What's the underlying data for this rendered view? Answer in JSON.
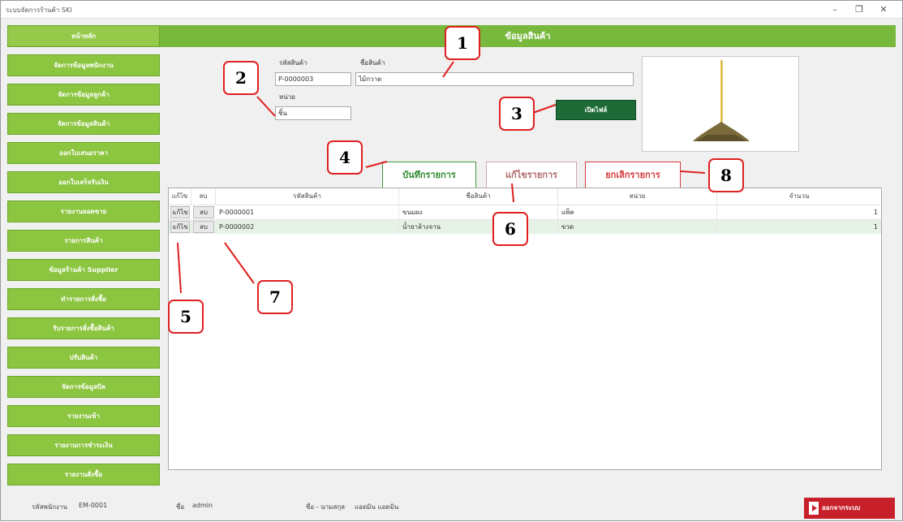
{
  "window": {
    "title": "ระบบจัดการร้านค้า SKI",
    "minimize": "–",
    "maximize": "❐",
    "close": "✕"
  },
  "sidebar": {
    "items": [
      {
        "label": "หน้าหลัก"
      },
      {
        "label": "จัดการข้อมูลพนักงาน"
      },
      {
        "label": "จัดการข้อมูลลูกค้า"
      },
      {
        "label": "จัดการข้อมูลสินค้า"
      },
      {
        "label": "ออกใบเสนอราคา"
      },
      {
        "label": "ออกใบเสร็จรับเงิน"
      },
      {
        "label": "รายงานยอดขาย"
      },
      {
        "label": "รายการสินค้า"
      },
      {
        "label": "ข้อมูลร้านค้า Supplier"
      },
      {
        "label": "ทำรายการสั่งซื้อ"
      },
      {
        "label": "รับรายการสั่งซื้อสินค้า"
      },
      {
        "label": "ปรับสินค้า"
      },
      {
        "label": "จัดการข้อมูลบิล"
      },
      {
        "label": "รายงานเข้า"
      },
      {
        "label": "รายงานการชำระเงิน"
      },
      {
        "label": "รายงานสั่งซื้อ"
      }
    ]
  },
  "header": {
    "title": "ข้อมูลสินค้า"
  },
  "form": {
    "code_label": "รหัสสินค้า",
    "code_value": "P-0000003",
    "name_label": "ชื่อสินค้า",
    "name_value": "ไม้กวาด",
    "unit_label": "หน่วย",
    "unit_value": "ชิ้น",
    "open_button": "เปิดไฟล์"
  },
  "actions": {
    "save": "บันทึกรายการ",
    "edit": "แก้ไขรายการ",
    "delete": "ยกเลิกรายการ"
  },
  "grid": {
    "columns": [
      "แก้ไข",
      "ลบ",
      "รหัสสินค้า",
      "ชื่อสินค้า",
      "หน่วย",
      "จำนวน"
    ],
    "rows": [
      {
        "edit": "แก้ไข",
        "del": "ลบ",
        "code": "P-0000001",
        "name": "ขนมผง",
        "unit": "แพ็ค",
        "qty": "1"
      },
      {
        "edit": "แก้ไข",
        "del": "ลบ",
        "code": "P-0000002",
        "name": "น้ำยาล้างจาน",
        "unit": "ขวด",
        "qty": "1"
      }
    ]
  },
  "footer": {
    "emp_label": "รหัสพนักงาน",
    "emp_value": "EM-0001",
    "user_label": "ชื่อ",
    "user_value": "admin",
    "name_label": "ชื่อ - นามสกุล",
    "name_value": "แอดมิน แอดมิน",
    "logout": "ออกจากระบบ"
  },
  "callouts": [
    "1",
    "2",
    "3",
    "4",
    "5",
    "6",
    "7",
    "8"
  ],
  "colors": {
    "sidebar": "#8cc540",
    "header": "#78b83c",
    "open_button": "#1e6b37",
    "logout": "#c8202a",
    "callout_border": "#e02020"
  }
}
